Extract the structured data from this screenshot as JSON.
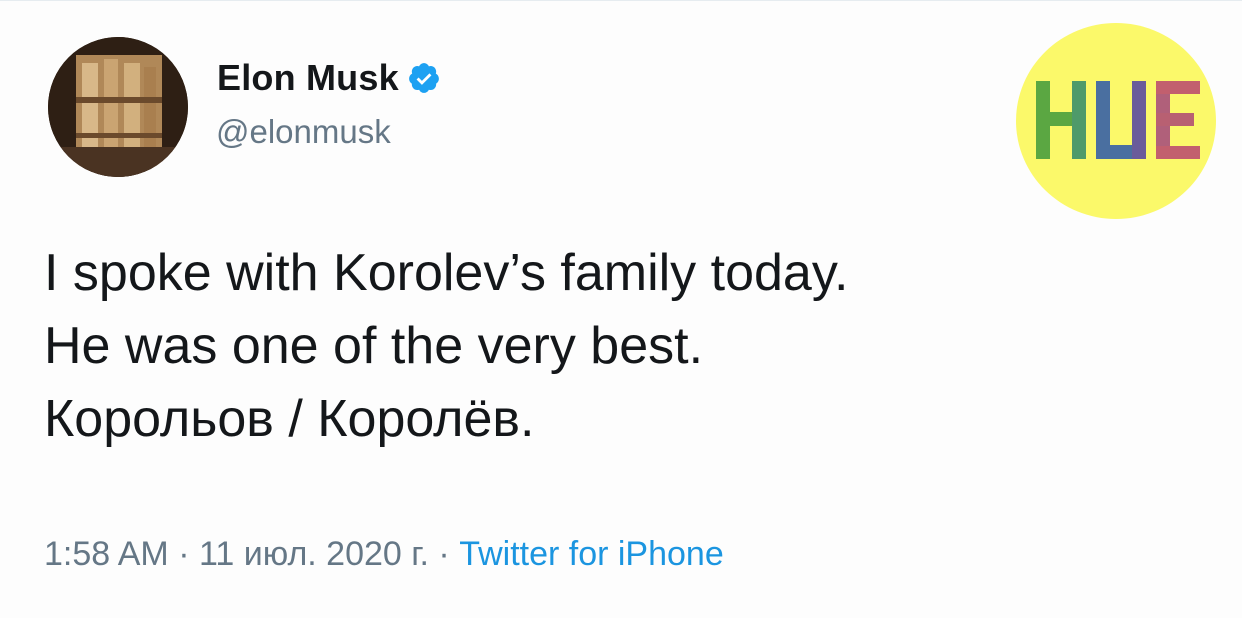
{
  "author": {
    "display_name": "Elon Musk",
    "handle": "@elonmusk",
    "verified": true
  },
  "tweet": {
    "lines": [
      "I spoke with Korolev’s family today.",
      "He was one of the very best.",
      "Корольов / Королёв."
    ]
  },
  "meta": {
    "time": "1:58 AM",
    "separator": " · ",
    "date": "11 июл. 2020 г.",
    "source": "Twitter for iPhone"
  },
  "watermark": {
    "text": "HUE",
    "background_color": "#fbf96a"
  },
  "colors": {
    "text": "#14171a",
    "secondary": "#657786",
    "link": "#1b95e0",
    "verified": "#1da1f2"
  }
}
